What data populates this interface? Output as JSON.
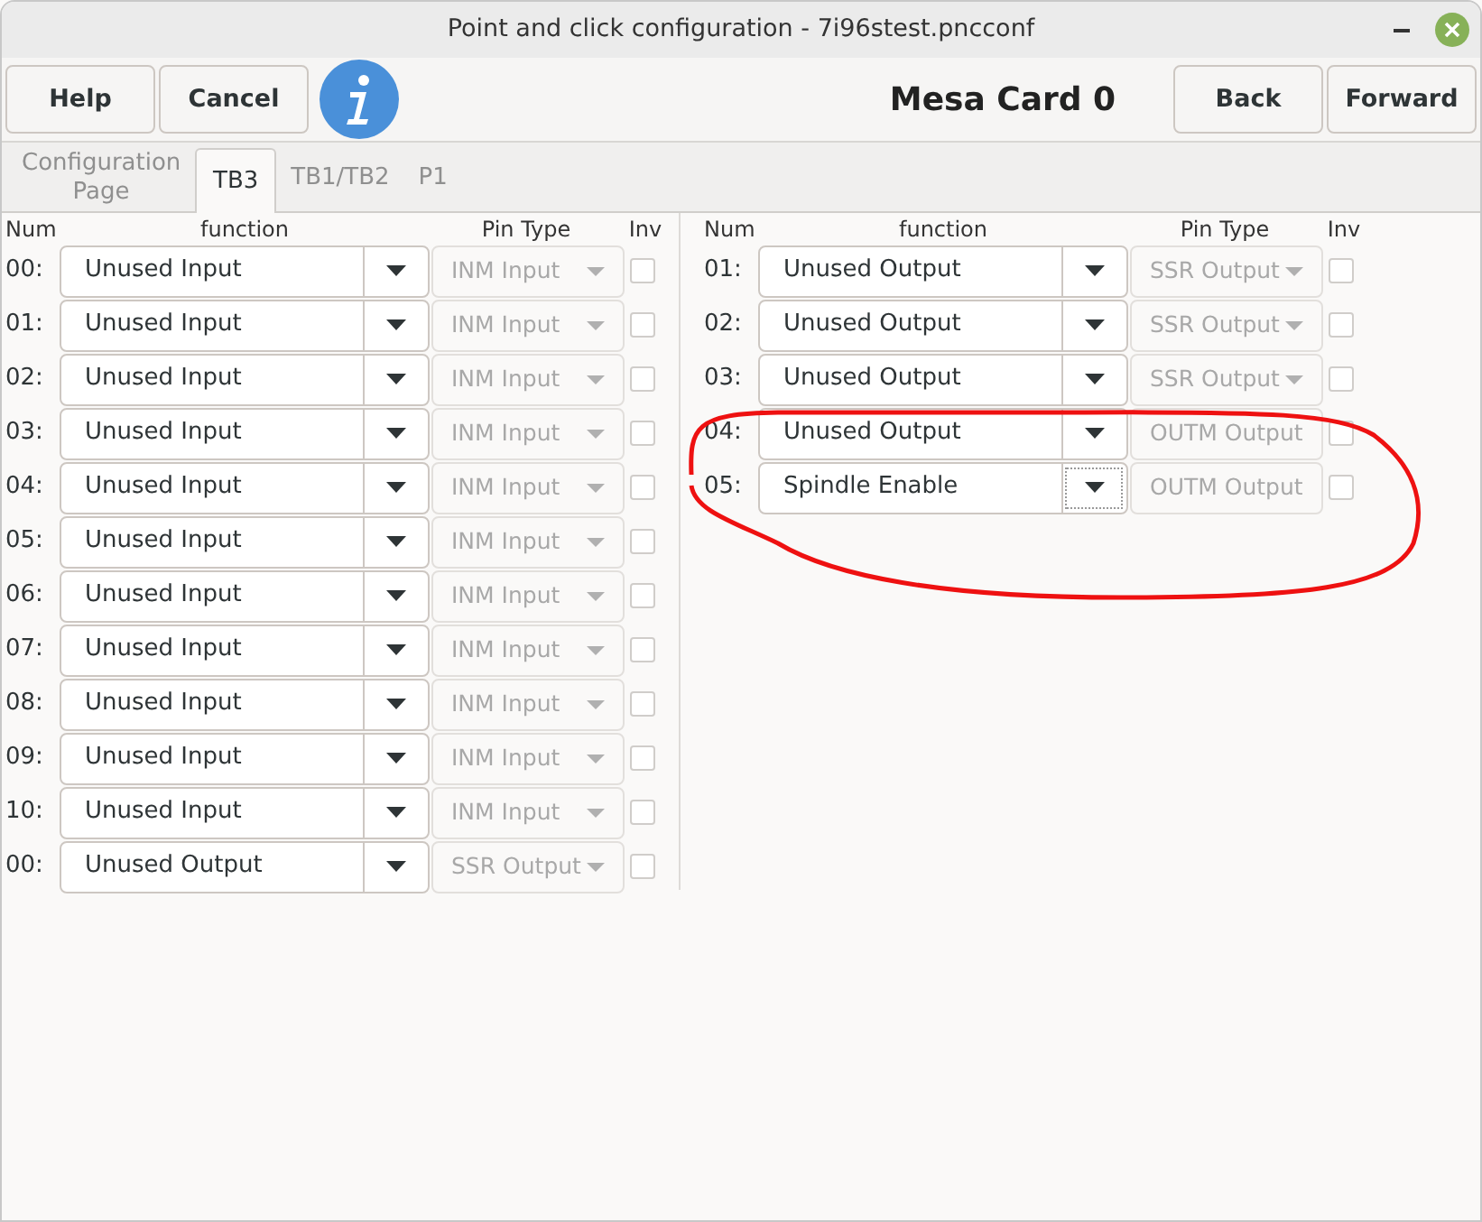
{
  "window": {
    "title": "Point and click configuration - 7i96stest.pncconf"
  },
  "toolbar": {
    "left_buttons": [
      "Help",
      "Cancel"
    ],
    "heading": "Mesa Card 0",
    "right_buttons": [
      "Back",
      "Forward"
    ]
  },
  "tabs": [
    {
      "label": "Configuration Page",
      "selected": false
    },
    {
      "label": "TB3",
      "selected": true
    },
    {
      "label": "TB1/TB2",
      "selected": false
    },
    {
      "label": "P1",
      "selected": false
    }
  ],
  "columns": [
    "Num",
    "function",
    "Pin Type",
    "Inv"
  ],
  "left_pins": [
    {
      "num": "00:",
      "function": "Unused Input",
      "pin_type": "INM Input",
      "checked": false,
      "focused": false
    },
    {
      "num": "01:",
      "function": "Unused Input",
      "pin_type": "INM Input",
      "checked": false,
      "focused": false
    },
    {
      "num": "02:",
      "function": "Unused Input",
      "pin_type": "INM Input",
      "checked": false,
      "focused": false
    },
    {
      "num": "03:",
      "function": "Unused Input",
      "pin_type": "INM Input",
      "checked": false,
      "focused": false
    },
    {
      "num": "04:",
      "function": "Unused Input",
      "pin_type": "INM Input",
      "checked": false,
      "focused": false
    },
    {
      "num": "05:",
      "function": "Unused Input",
      "pin_type": "INM Input",
      "checked": false,
      "focused": false
    },
    {
      "num": "06:",
      "function": "Unused Input",
      "pin_type": "INM Input",
      "checked": false,
      "focused": false
    },
    {
      "num": "07:",
      "function": "Unused Input",
      "pin_type": "INM Input",
      "checked": false,
      "focused": false
    },
    {
      "num": "08:",
      "function": "Unused Input",
      "pin_type": "INM Input",
      "checked": false,
      "focused": false
    },
    {
      "num": "09:",
      "function": "Unused Input",
      "pin_type": "INM Input",
      "checked": false,
      "focused": false
    },
    {
      "num": "10:",
      "function": "Unused Input",
      "pin_type": "INM Input",
      "checked": false,
      "focused": false
    },
    {
      "num": "00:",
      "function": "Unused Output",
      "pin_type": "SSR Output",
      "checked": false,
      "focused": false
    }
  ],
  "right_columns": [
    "Num",
    "function",
    "Pin Type",
    "Inv"
  ],
  "right_pins": [
    {
      "num": "01:",
      "function": "Unused Output",
      "pin_type": "SSR Output",
      "checked": false,
      "focused": false
    },
    {
      "num": "02:",
      "function": "Unused Output",
      "pin_type": "SSR Output",
      "checked": false,
      "focused": false
    },
    {
      "num": "03:",
      "function": "Unused Output",
      "pin_type": "SSR Output",
      "checked": false,
      "focused": false
    },
    {
      "num": "04:",
      "function": "Unused Output",
      "pin_type": "OUTM Output",
      "checked": false,
      "focused": false
    },
    {
      "num": "05:",
      "function": "Spindle Enable",
      "pin_type": "OUTM Output",
      "checked": false,
      "focused": true
    }
  ]
}
